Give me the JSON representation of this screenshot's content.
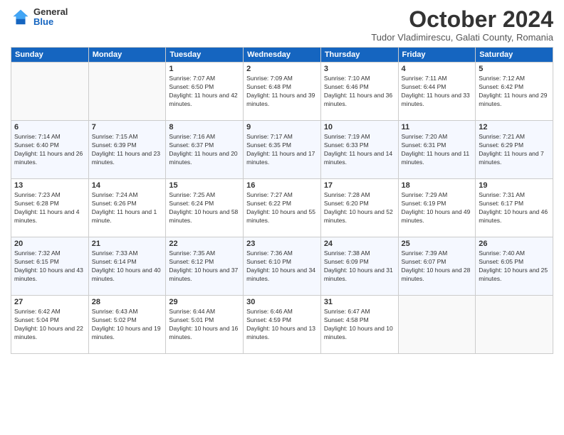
{
  "logo": {
    "general": "General",
    "blue": "Blue"
  },
  "title": "October 2024",
  "location": "Tudor Vladimirescu, Galati County, Romania",
  "weekdays": [
    "Sunday",
    "Monday",
    "Tuesday",
    "Wednesday",
    "Thursday",
    "Friday",
    "Saturday"
  ],
  "weeks": [
    [
      {
        "day": "",
        "sunrise": "",
        "sunset": "",
        "daylight": ""
      },
      {
        "day": "",
        "sunrise": "",
        "sunset": "",
        "daylight": ""
      },
      {
        "day": "1",
        "sunrise": "Sunrise: 7:07 AM",
        "sunset": "Sunset: 6:50 PM",
        "daylight": "Daylight: 11 hours and 42 minutes."
      },
      {
        "day": "2",
        "sunrise": "Sunrise: 7:09 AM",
        "sunset": "Sunset: 6:48 PM",
        "daylight": "Daylight: 11 hours and 39 minutes."
      },
      {
        "day": "3",
        "sunrise": "Sunrise: 7:10 AM",
        "sunset": "Sunset: 6:46 PM",
        "daylight": "Daylight: 11 hours and 36 minutes."
      },
      {
        "day": "4",
        "sunrise": "Sunrise: 7:11 AM",
        "sunset": "Sunset: 6:44 PM",
        "daylight": "Daylight: 11 hours and 33 minutes."
      },
      {
        "day": "5",
        "sunrise": "Sunrise: 7:12 AM",
        "sunset": "Sunset: 6:42 PM",
        "daylight": "Daylight: 11 hours and 29 minutes."
      }
    ],
    [
      {
        "day": "6",
        "sunrise": "Sunrise: 7:14 AM",
        "sunset": "Sunset: 6:40 PM",
        "daylight": "Daylight: 11 hours and 26 minutes."
      },
      {
        "day": "7",
        "sunrise": "Sunrise: 7:15 AM",
        "sunset": "Sunset: 6:39 PM",
        "daylight": "Daylight: 11 hours and 23 minutes."
      },
      {
        "day": "8",
        "sunrise": "Sunrise: 7:16 AM",
        "sunset": "Sunset: 6:37 PM",
        "daylight": "Daylight: 11 hours and 20 minutes."
      },
      {
        "day": "9",
        "sunrise": "Sunrise: 7:17 AM",
        "sunset": "Sunset: 6:35 PM",
        "daylight": "Daylight: 11 hours and 17 minutes."
      },
      {
        "day": "10",
        "sunrise": "Sunrise: 7:19 AM",
        "sunset": "Sunset: 6:33 PM",
        "daylight": "Daylight: 11 hours and 14 minutes."
      },
      {
        "day": "11",
        "sunrise": "Sunrise: 7:20 AM",
        "sunset": "Sunset: 6:31 PM",
        "daylight": "Daylight: 11 hours and 11 minutes."
      },
      {
        "day": "12",
        "sunrise": "Sunrise: 7:21 AM",
        "sunset": "Sunset: 6:29 PM",
        "daylight": "Daylight: 11 hours and 7 minutes."
      }
    ],
    [
      {
        "day": "13",
        "sunrise": "Sunrise: 7:23 AM",
        "sunset": "Sunset: 6:28 PM",
        "daylight": "Daylight: 11 hours and 4 minutes."
      },
      {
        "day": "14",
        "sunrise": "Sunrise: 7:24 AM",
        "sunset": "Sunset: 6:26 PM",
        "daylight": "Daylight: 11 hours and 1 minute."
      },
      {
        "day": "15",
        "sunrise": "Sunrise: 7:25 AM",
        "sunset": "Sunset: 6:24 PM",
        "daylight": "Daylight: 10 hours and 58 minutes."
      },
      {
        "day": "16",
        "sunrise": "Sunrise: 7:27 AM",
        "sunset": "Sunset: 6:22 PM",
        "daylight": "Daylight: 10 hours and 55 minutes."
      },
      {
        "day": "17",
        "sunrise": "Sunrise: 7:28 AM",
        "sunset": "Sunset: 6:20 PM",
        "daylight": "Daylight: 10 hours and 52 minutes."
      },
      {
        "day": "18",
        "sunrise": "Sunrise: 7:29 AM",
        "sunset": "Sunset: 6:19 PM",
        "daylight": "Daylight: 10 hours and 49 minutes."
      },
      {
        "day": "19",
        "sunrise": "Sunrise: 7:31 AM",
        "sunset": "Sunset: 6:17 PM",
        "daylight": "Daylight: 10 hours and 46 minutes."
      }
    ],
    [
      {
        "day": "20",
        "sunrise": "Sunrise: 7:32 AM",
        "sunset": "Sunset: 6:15 PM",
        "daylight": "Daylight: 10 hours and 43 minutes."
      },
      {
        "day": "21",
        "sunrise": "Sunrise: 7:33 AM",
        "sunset": "Sunset: 6:14 PM",
        "daylight": "Daylight: 10 hours and 40 minutes."
      },
      {
        "day": "22",
        "sunrise": "Sunrise: 7:35 AM",
        "sunset": "Sunset: 6:12 PM",
        "daylight": "Daylight: 10 hours and 37 minutes."
      },
      {
        "day": "23",
        "sunrise": "Sunrise: 7:36 AM",
        "sunset": "Sunset: 6:10 PM",
        "daylight": "Daylight: 10 hours and 34 minutes."
      },
      {
        "day": "24",
        "sunrise": "Sunrise: 7:38 AM",
        "sunset": "Sunset: 6:09 PM",
        "daylight": "Daylight: 10 hours and 31 minutes."
      },
      {
        "day": "25",
        "sunrise": "Sunrise: 7:39 AM",
        "sunset": "Sunset: 6:07 PM",
        "daylight": "Daylight: 10 hours and 28 minutes."
      },
      {
        "day": "26",
        "sunrise": "Sunrise: 7:40 AM",
        "sunset": "Sunset: 6:05 PM",
        "daylight": "Daylight: 10 hours and 25 minutes."
      }
    ],
    [
      {
        "day": "27",
        "sunrise": "Sunrise: 6:42 AM",
        "sunset": "Sunset: 5:04 PM",
        "daylight": "Daylight: 10 hours and 22 minutes."
      },
      {
        "day": "28",
        "sunrise": "Sunrise: 6:43 AM",
        "sunset": "Sunset: 5:02 PM",
        "daylight": "Daylight: 10 hours and 19 minutes."
      },
      {
        "day": "29",
        "sunrise": "Sunrise: 6:44 AM",
        "sunset": "Sunset: 5:01 PM",
        "daylight": "Daylight: 10 hours and 16 minutes."
      },
      {
        "day": "30",
        "sunrise": "Sunrise: 6:46 AM",
        "sunset": "Sunset: 4:59 PM",
        "daylight": "Daylight: 10 hours and 13 minutes."
      },
      {
        "day": "31",
        "sunrise": "Sunrise: 6:47 AM",
        "sunset": "Sunset: 4:58 PM",
        "daylight": "Daylight: 10 hours and 10 minutes."
      },
      {
        "day": "",
        "sunrise": "",
        "sunset": "",
        "daylight": ""
      },
      {
        "day": "",
        "sunrise": "",
        "sunset": "",
        "daylight": ""
      }
    ]
  ]
}
